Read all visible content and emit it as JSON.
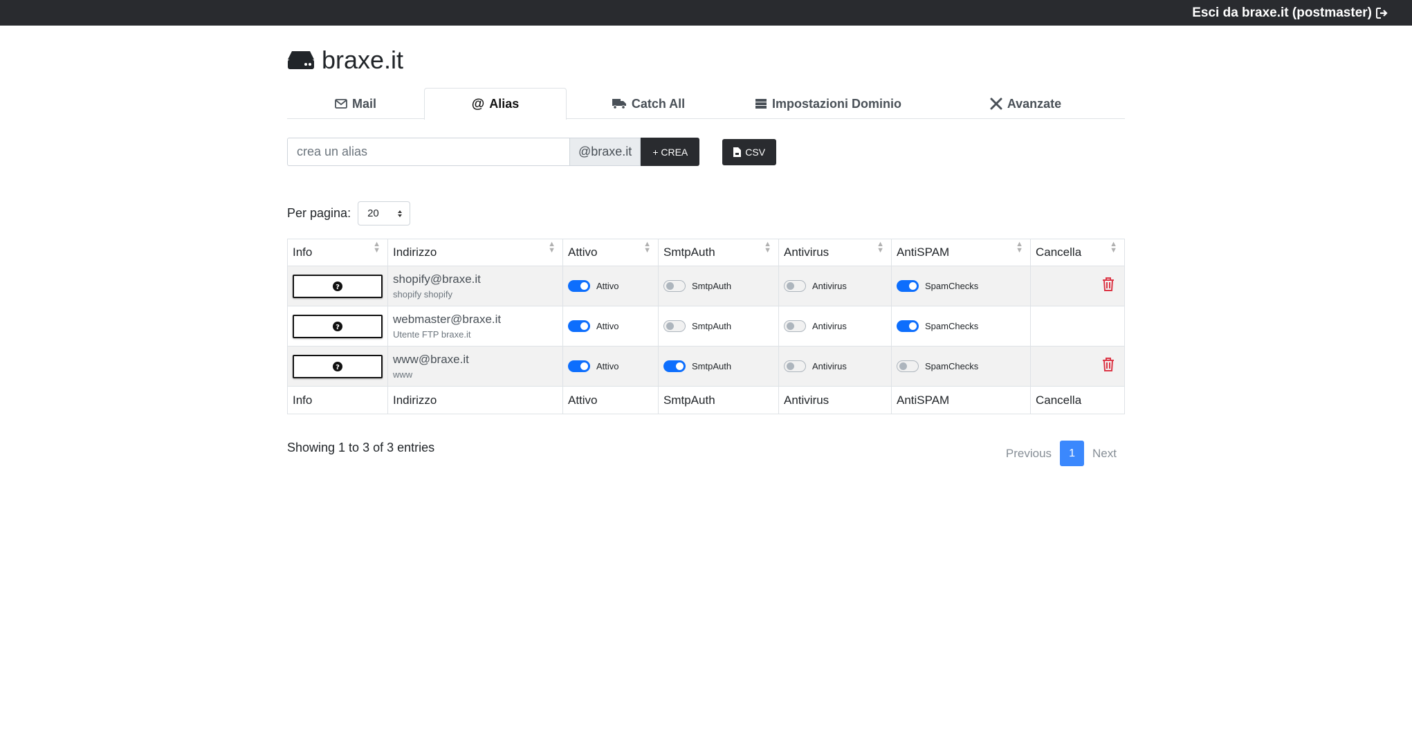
{
  "topbar": {
    "logout_label": "Esci da braxe.it (postmaster)"
  },
  "brand": {
    "title": "braxe.it"
  },
  "tabs": [
    {
      "label": "Mail",
      "icon": "envelope-icon",
      "active": false
    },
    {
      "label": "Alias",
      "icon": "at-icon",
      "active": true
    },
    {
      "label": "Catch All",
      "icon": "truck-icon",
      "active": false
    },
    {
      "label": "Impostazioni Dominio",
      "icon": "server-icon",
      "active": false
    },
    {
      "label": "Avanzate",
      "icon": "tools-icon",
      "active": false
    }
  ],
  "create": {
    "placeholder": "crea un alias",
    "domain_suffix": "@braxe.it",
    "create_label": "+ CREA",
    "csv_label": "CSV"
  },
  "perpage": {
    "label": "Per pagina:",
    "value": "20"
  },
  "table": {
    "headers": [
      "Info",
      "Indirizzo",
      "Attivo",
      "SmtpAuth",
      "Antivirus",
      "AntiSPAM",
      "Cancella"
    ],
    "rows": [
      {
        "address": "shopify@braxe.it",
        "description": "shopify shopify",
        "attivo": {
          "label": "Attivo",
          "on": true
        },
        "smtpauth": {
          "label": "SmtpAuth",
          "on": false
        },
        "antivirus": {
          "label": "Antivirus",
          "on": false
        },
        "antispam": {
          "label": "SpamChecks",
          "on": true
        },
        "deletable": true
      },
      {
        "address": "webmaster@braxe.it",
        "description": "Utente FTP braxe.it",
        "attivo": {
          "label": "Attivo",
          "on": true
        },
        "smtpauth": {
          "label": "SmtpAuth",
          "on": false
        },
        "antivirus": {
          "label": "Antivirus",
          "on": false
        },
        "antispam": {
          "label": "SpamChecks",
          "on": true
        },
        "deletable": false
      },
      {
        "address": "www@braxe.it",
        "description": "www",
        "attivo": {
          "label": "Attivo",
          "on": true
        },
        "smtpauth": {
          "label": "SmtpAuth",
          "on": true
        },
        "antivirus": {
          "label": "Antivirus",
          "on": false
        },
        "antispam": {
          "label": "SpamChecks",
          "on": false
        },
        "deletable": true
      }
    ]
  },
  "footer": {
    "entries": "Showing 1 to 3 of 3 entries",
    "previous": "Previous",
    "current_page": "1",
    "next": "Next"
  },
  "colors": {
    "topbar": "#292b2f",
    "accent": "#0d6efd",
    "danger": "#dc3545"
  }
}
